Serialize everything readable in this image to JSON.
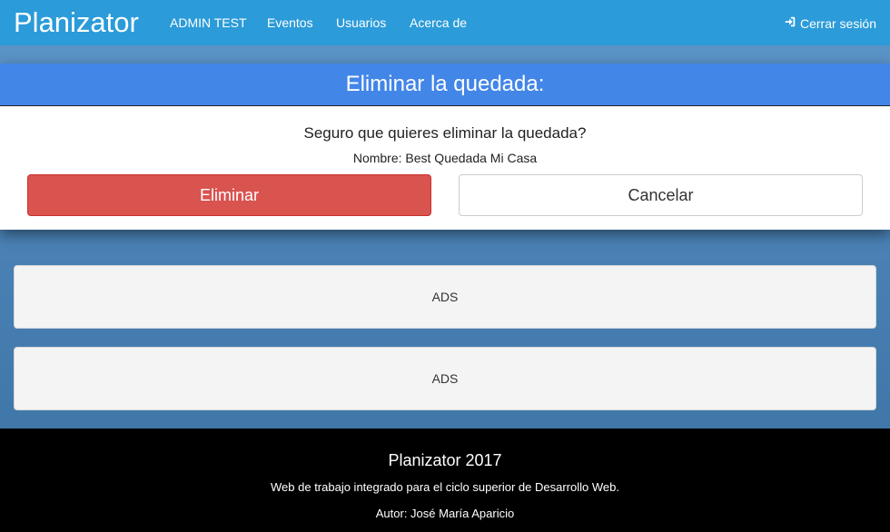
{
  "navbar": {
    "brand": "Planizator",
    "items": [
      {
        "label": "ADMIN TEST"
      },
      {
        "label": "Eventos"
      },
      {
        "label": "Usuarios"
      },
      {
        "label": "Acerca de"
      }
    ],
    "logout": {
      "label": "Cerrar sesión",
      "icon": "sign-in-icon"
    }
  },
  "colors": {
    "navbar": "#2b9bd9",
    "panel_header": "#4286e8",
    "danger": "#d9534f",
    "footer": "#000000"
  },
  "dialog": {
    "title": "Eliminar la quedada:",
    "question": "Seguro que quieres eliminar la quedada?",
    "name_line": "Nombre: Best Quedada Mi Casa",
    "confirm_label": "Eliminar",
    "cancel_label": "Cancelar"
  },
  "ads": [
    {
      "label": "ADS"
    },
    {
      "label": "ADS"
    }
  ],
  "footer": {
    "title": "Planizator 2017",
    "description": "Web de trabajo integrado para el ciclo superior de Desarrollo Web.",
    "author": "Autor: José María Aparicio"
  }
}
